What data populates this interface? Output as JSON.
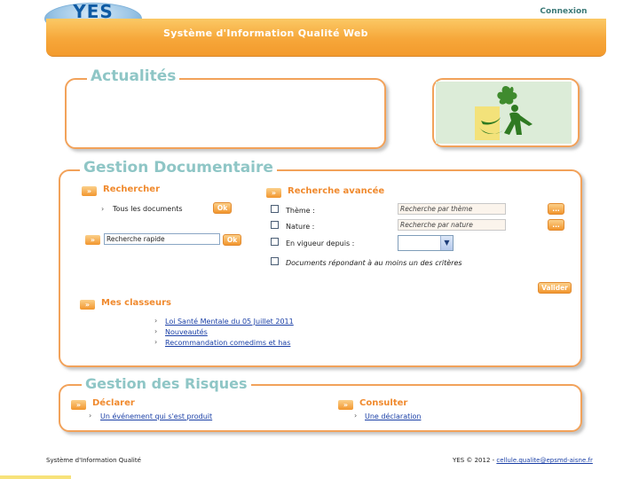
{
  "header": {
    "logo_text": "YES",
    "login_label": "Connexion",
    "app_title": "Système d'Information Qualité Web"
  },
  "news": {
    "title": "Actualités"
  },
  "docs": {
    "title": "Gestion Documentaire",
    "search": {
      "label": "Rechercher",
      "all_documents": "Tous les documents",
      "ok_label": "Ok",
      "quick_value": "Recherche rapide",
      "quick_ok_label": "Ok"
    },
    "advanced": {
      "label": "Recherche avancée",
      "theme_label": "Thème :",
      "theme_placeholder": "Recherche par thème",
      "nature_label": "Nature :",
      "nature_placeholder": "Recherche par nature",
      "browse_label": "...",
      "since_label": "En vigueur depuis :",
      "criteria_label": "Documents répondant à au moins un des critères",
      "submit_label": "Valider"
    },
    "binders": {
      "label": "Mes classeurs",
      "items": [
        "Loi Santé Mentale du 05 Juillet 2011",
        "Nouveautés",
        "Recommandation comedims et has"
      ]
    }
  },
  "risks": {
    "title": "Gestion des Risques",
    "declare": {
      "label": "Déclarer",
      "link": "Un événement qui s'est produit"
    },
    "consult": {
      "label": "Consulter",
      "link": "Une déclaration"
    }
  },
  "footer": {
    "left_text": "Système d'Information Qualité",
    "right_prefix": "YES © 2012 - ",
    "email": "cellule.qualite@epsmd-aisne.fr"
  },
  "colors": {
    "accent_orange": "#f39a2c",
    "frame_border": "#f2a25a",
    "frame_title": "#8fc6c6",
    "link_blue": "#1a3fa6"
  },
  "icons": [
    "chevron-right-icon",
    "double-arrow-icon",
    "dropdown-arrow-icon",
    "green-figure-illustration"
  ]
}
